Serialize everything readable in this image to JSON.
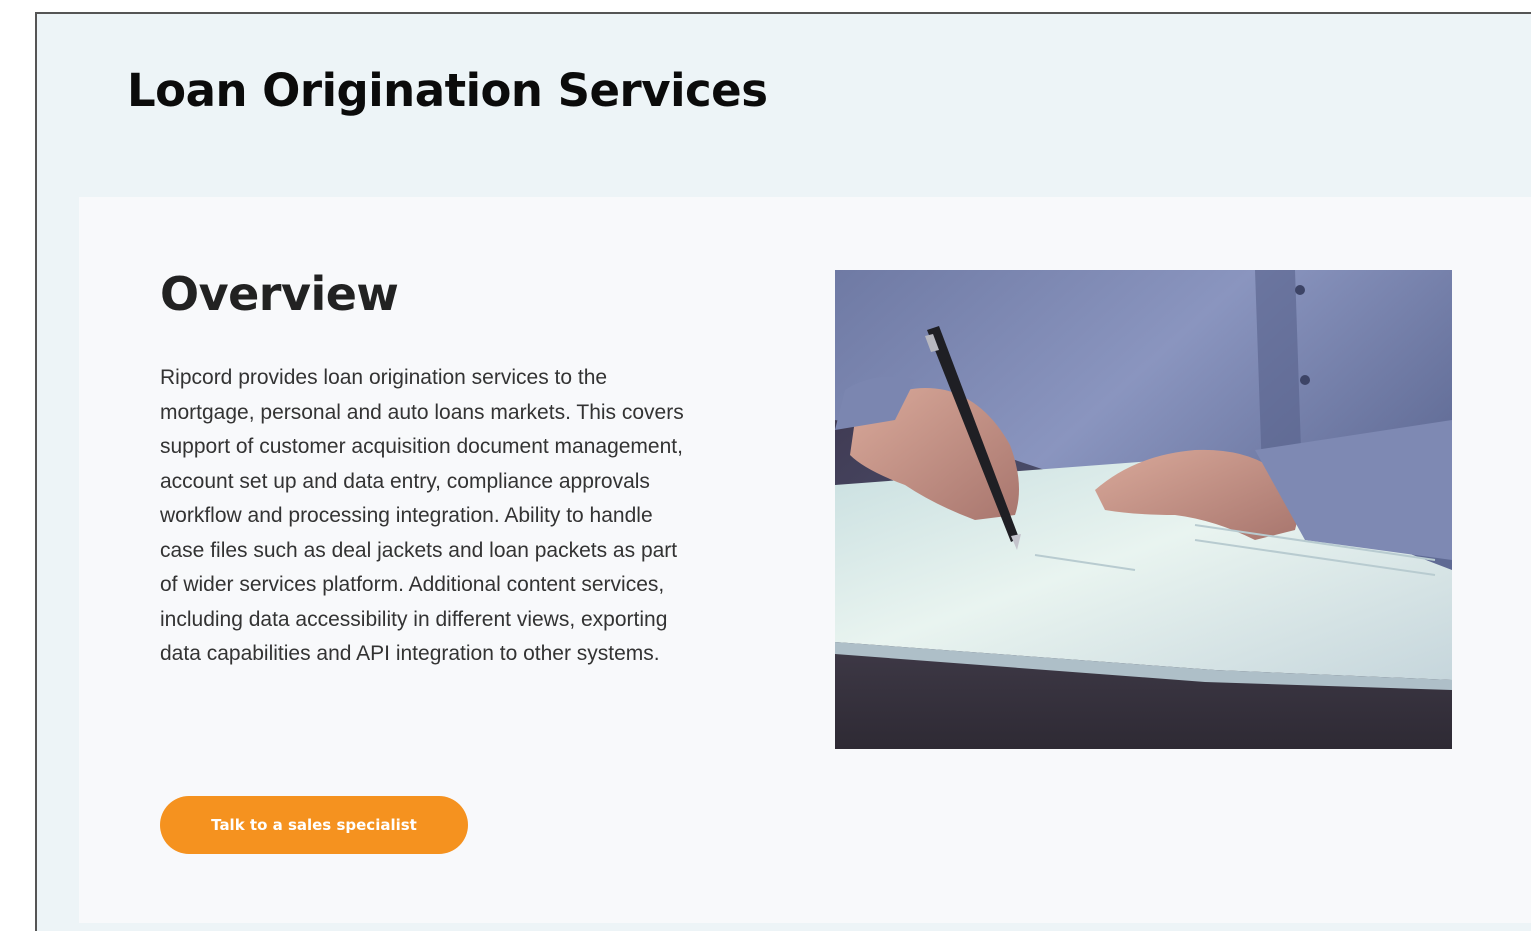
{
  "header": {
    "title": "Loan Origination Services"
  },
  "overview": {
    "title": "Overview",
    "body": "Ripcord provides loan origination services to the mortgage, personal and auto loans markets. This covers support of customer acquisition document management, account set up and data entry, compliance approvals workflow and processing integration. Ability to handle case files such as deal jackets and loan packets as part of wider services platform. Additional content services, including data accessibility in different views, exporting data capabilities and API integration to other systems.",
    "cta_label": "Talk to a sales specialist"
  },
  "colors": {
    "accent": "#f5921f",
    "page_background": "#edf4f7",
    "card_background": "#f8f9fb",
    "heading": "#0b0b0b",
    "body_text": "#333333"
  }
}
